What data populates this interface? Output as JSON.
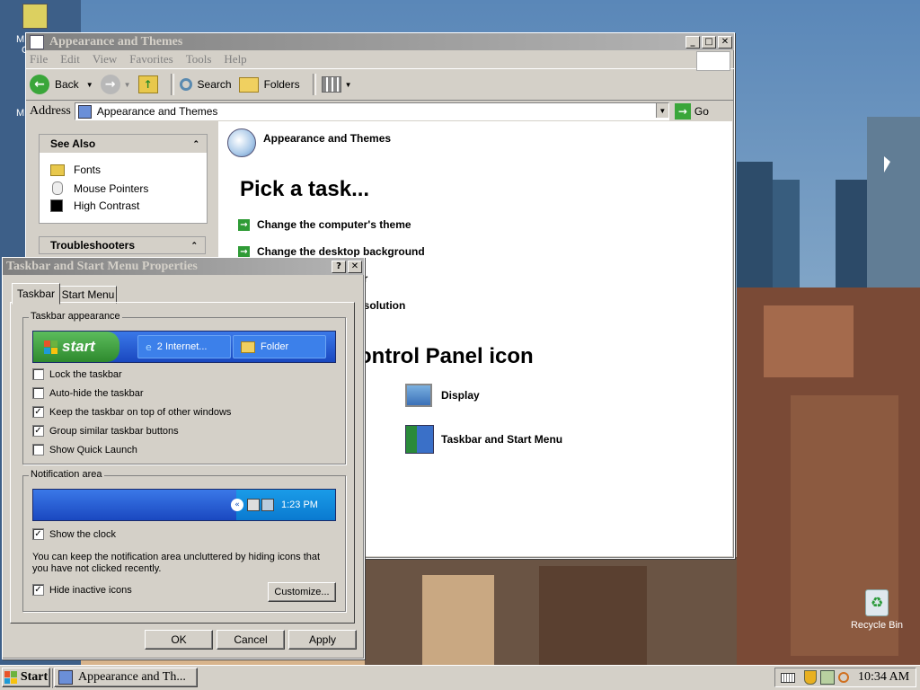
{
  "desktop": {
    "left_labels": [
      "M",
      "C",
      "M"
    ],
    "recycle_bin": "Recycle Bin"
  },
  "explorer": {
    "title": "Appearance and Themes",
    "menu": [
      "File",
      "Edit",
      "View",
      "Favorites",
      "Tools",
      "Help"
    ],
    "toolbar": {
      "back": "Back",
      "search": "Search",
      "folders": "Folders"
    },
    "address_label": "Address",
    "address_value": "Appearance and Themes",
    "go": "Go",
    "see_also": {
      "title": "See Also",
      "items": [
        "Fonts",
        "Mouse Pointers",
        "High Contrast"
      ]
    },
    "troubleshooters": "Troubleshooters",
    "heading": "Appearance and Themes",
    "pick_task": "Pick a task...",
    "tasks": [
      "Change the computer's theme",
      "Change the desktop background",
      "er",
      "esolution"
    ],
    "or_pick": "ontrol Panel icon",
    "icons": [
      "Display",
      "Taskbar and Start Menu"
    ]
  },
  "dialog": {
    "title": "Taskbar and Start Menu Properties",
    "tabs": [
      "Taskbar",
      "Start Menu"
    ],
    "appearance_group": "Taskbar appearance",
    "preview": {
      "start": "start",
      "btn1": "2 Internet...",
      "btn2": "Folder"
    },
    "options": [
      {
        "label": "Lock the taskbar",
        "checked": false
      },
      {
        "label": "Auto-hide the taskbar",
        "checked": false
      },
      {
        "label": "Keep the taskbar on top of other windows",
        "checked": true
      },
      {
        "label": "Group similar taskbar buttons",
        "checked": true
      },
      {
        "label": "Show Quick Launch",
        "checked": false
      }
    ],
    "notification_group": "Notification area",
    "notif_time": "1:23 PM",
    "show_clock": "Show the clock",
    "info_text": "You can keep the notification area uncluttered by hiding icons that you have not clicked recently.",
    "hide_inactive": "Hide inactive icons",
    "customize": "Customize...",
    "ok": "OK",
    "cancel": "Cancel",
    "apply": "Apply"
  },
  "taskbar": {
    "start": "Start",
    "task_button": "Appearance and Th...",
    "clock": "10:34 AM"
  },
  "colors": {
    "xp_blue": "#2458d8",
    "start_green": "#3c9c3c",
    "task_arrow": "#2f9b36"
  }
}
